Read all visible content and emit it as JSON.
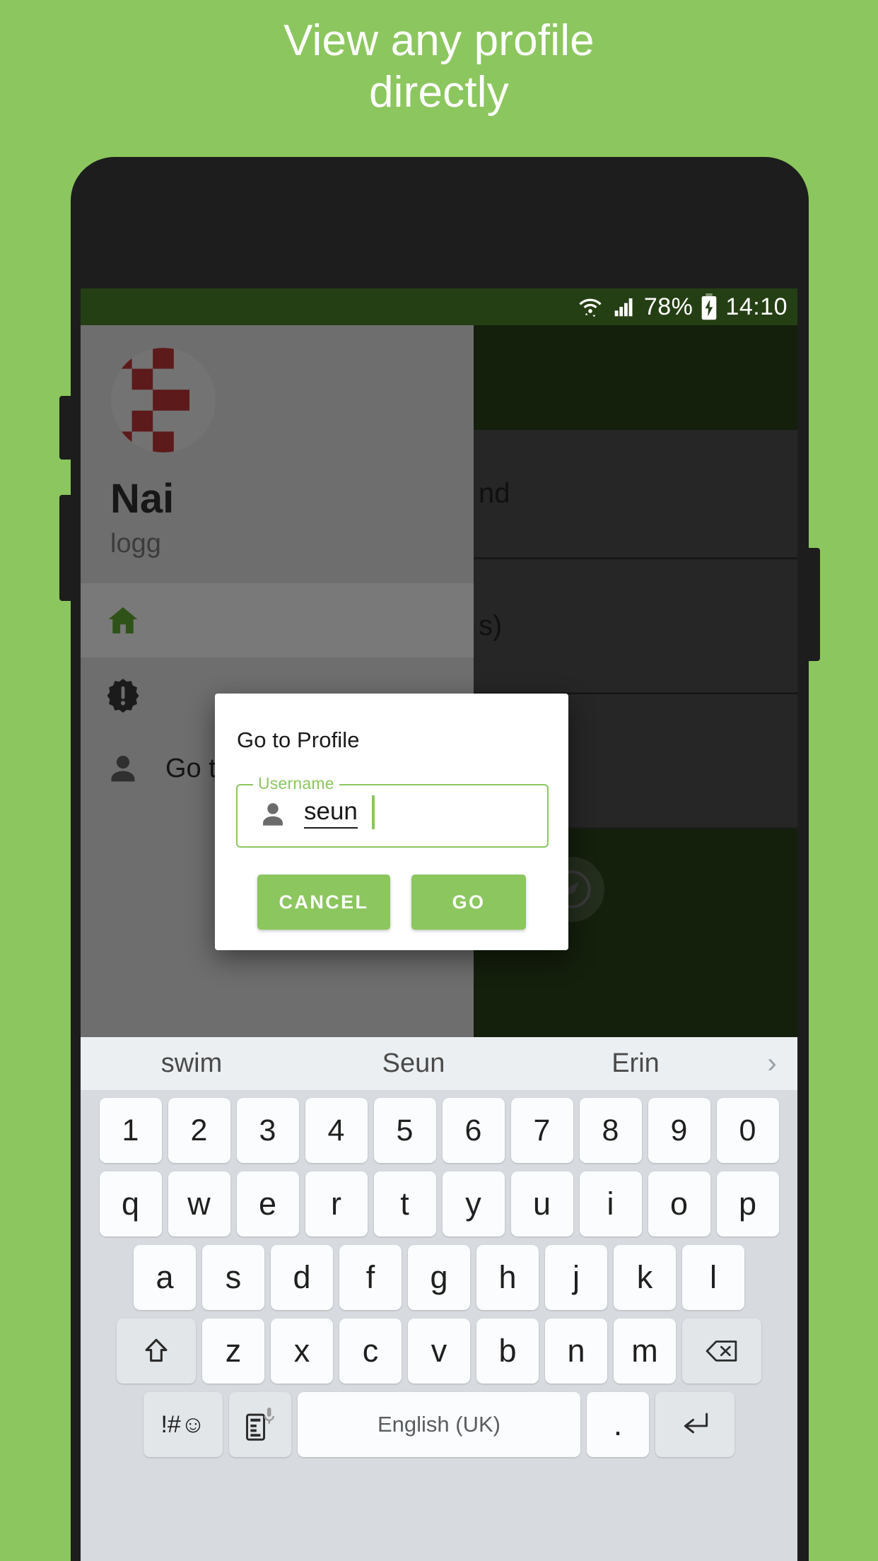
{
  "promo": {
    "headline_line1": "View any profile",
    "headline_line2": "directly",
    "background_color": "#8cc65e"
  },
  "statusbar": {
    "wifi_icon": "wifi-icon",
    "signal_icon": "signal-icon",
    "battery_percent": "78%",
    "battery_icon": "battery-charging-icon",
    "time": "14:10",
    "background_color": "#253f14"
  },
  "drawer": {
    "avatar": "user-avatar-checkered",
    "name": "Nai",
    "subtitle": "logg",
    "items": [
      {
        "label": "",
        "icon": "home-icon",
        "selected": true
      },
      {
        "label": "",
        "icon": "badge-alert-icon",
        "selected": false
      },
      {
        "label": "Go to Profile",
        "icon": "person-icon",
        "selected": false
      }
    ]
  },
  "app_behind": {
    "row1_text": "nd",
    "row2_text": "",
    "row3_text": "s)",
    "fab_icon": "compass-icon"
  },
  "dialog": {
    "title": "Go to Profile",
    "field": {
      "label": "Username",
      "value": "seun",
      "placeholder": "Username",
      "icon": "person-icon",
      "accent_color": "#8cc65e"
    },
    "buttons": {
      "cancel": "CANCEL",
      "go": "GO"
    }
  },
  "keyboard": {
    "suggestions": [
      "swim",
      "Seun",
      "Erin"
    ],
    "expand_icon": "chevron-right-icon",
    "rows": {
      "numbers": [
        "1",
        "2",
        "3",
        "4",
        "5",
        "6",
        "7",
        "8",
        "9",
        "0"
      ],
      "top": [
        "q",
        "w",
        "e",
        "r",
        "t",
        "y",
        "u",
        "i",
        "o",
        "p"
      ],
      "home": [
        "a",
        "s",
        "d",
        "f",
        "g",
        "h",
        "j",
        "k",
        "l"
      ],
      "bottom": [
        "z",
        "x",
        "c",
        "v",
        "b",
        "n",
        "m"
      ]
    },
    "shift_icon": "shift-icon",
    "backspace_icon": "backspace-icon",
    "symbols_key": "!#☺",
    "clipboard_icon": "clipboard-mic-icon",
    "space_label": "English (UK)",
    "period_key": ".",
    "enter_icon": "enter-icon"
  }
}
